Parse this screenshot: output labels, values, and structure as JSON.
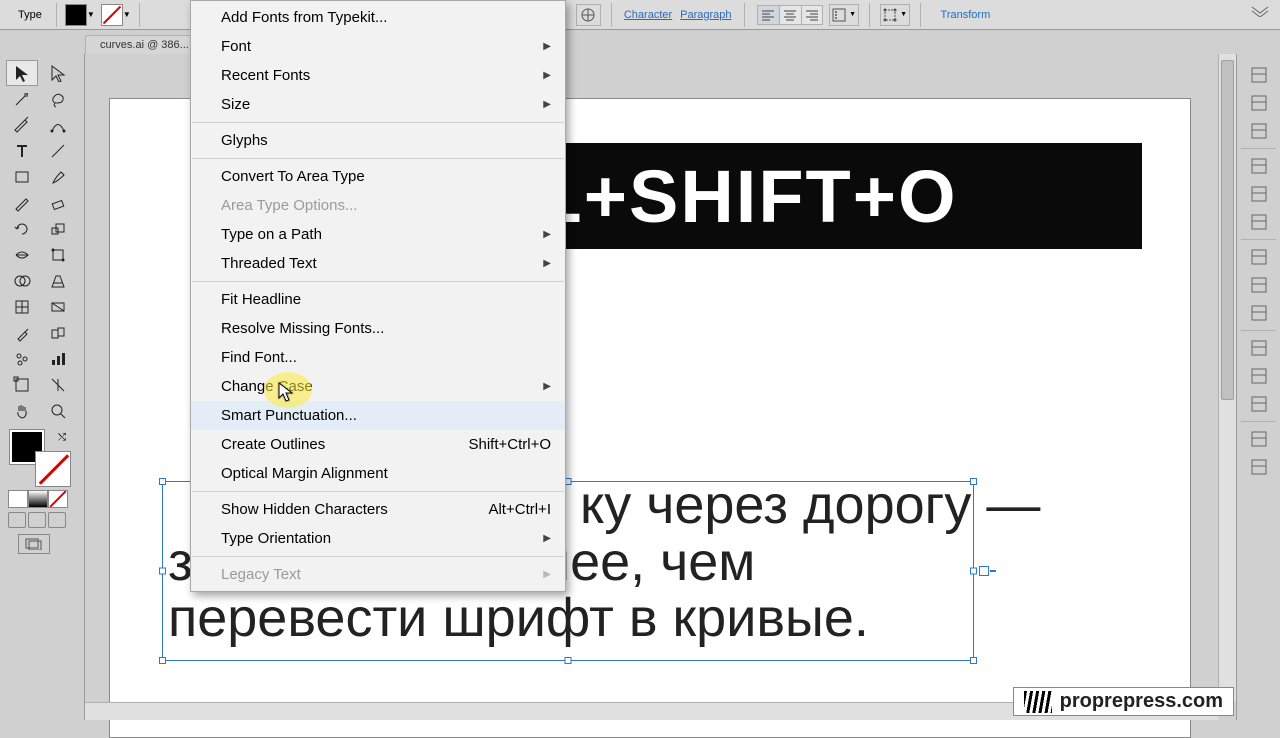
{
  "optionsbar": {
    "tool_label": "Type",
    "character_link": "Character",
    "paragraph_link": "Paragraph",
    "transform_link": "Transform"
  },
  "document": {
    "tab_label": "curves.ai @ 386..."
  },
  "canvas": {
    "headline": "CTRL+SHIFT+O",
    "paragraph_line1_visible": "ку через дорогу —",
    "paragraph_line2": "задача посложнее, чем",
    "paragraph_line3": "перевести шрифт в кривые."
  },
  "menu": {
    "items": [
      {
        "label": "Add Fonts from Typekit...",
        "disabled": false
      },
      {
        "label": "Font",
        "submenu": true
      },
      {
        "label": "Recent Fonts",
        "submenu": true
      },
      {
        "label": "Size",
        "submenu": true
      },
      {
        "sep": true
      },
      {
        "label": "Glyphs"
      },
      {
        "sep": true
      },
      {
        "label": "Convert To Area Type"
      },
      {
        "label": "Area Type Options...",
        "disabled": true
      },
      {
        "label": "Type on a Path",
        "submenu": true
      },
      {
        "label": "Threaded Text",
        "submenu": true
      },
      {
        "sep": true
      },
      {
        "label": "Fit Headline"
      },
      {
        "label": "Resolve Missing Fonts..."
      },
      {
        "label": "Find Font..."
      },
      {
        "label": "Change Case",
        "submenu": true
      },
      {
        "label": "Smart Punctuation...",
        "hover": true
      },
      {
        "label": "Create Outlines",
        "shortcut": "Shift+Ctrl+O"
      },
      {
        "label": "Optical Margin Alignment"
      },
      {
        "sep": true
      },
      {
        "label": "Show Hidden Characters",
        "shortcut": "Alt+Ctrl+I"
      },
      {
        "label": "Type Orientation",
        "submenu": true
      },
      {
        "sep": true
      },
      {
        "label": "Legacy Text",
        "submenu": true,
        "disabled": true
      }
    ]
  },
  "watermark": {
    "text": "proprepress.com"
  },
  "tools": [
    "selection",
    "direct-selection",
    "magic-wand",
    "lasso",
    "pen",
    "curvature",
    "type",
    "line-segment",
    "rectangle",
    "paintbrush",
    "pencil",
    "eraser",
    "rotate",
    "scale",
    "width",
    "free-transform",
    "shape-builder",
    "perspective",
    "mesh",
    "gradient",
    "eyedropper",
    "blend",
    "symbol-sprayer",
    "column-graph",
    "artboard",
    "slice",
    "hand",
    "zoom"
  ],
  "right_panels": [
    "color",
    "color-guide",
    "swatches",
    "brushes",
    "symbols",
    "stroke",
    "gradient",
    "transparency",
    "appearance",
    "graphic-styles",
    "layers",
    "align",
    "pathfinder",
    "navigator"
  ]
}
